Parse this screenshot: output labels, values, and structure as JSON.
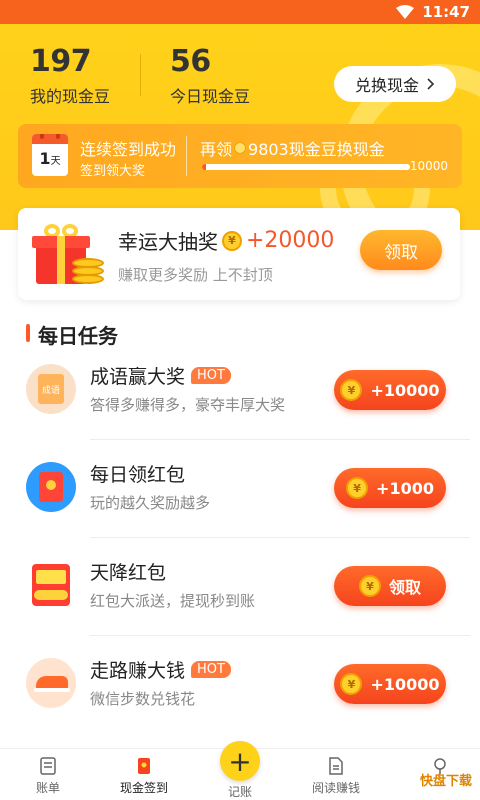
{
  "status_bar": {
    "time": "11:47"
  },
  "header": {
    "cash_balance": "197",
    "cash_balance_label": "我的现金豆",
    "today_balance": "56",
    "today_balance_label": "今日现金豆",
    "exchange_button": "兑换现金"
  },
  "signin": {
    "calendar_day": "1",
    "calendar_unit": "天",
    "title": "连续签到成功",
    "subtitle": "签到领大奖",
    "goal_prefix": "再领",
    "goal_suffix": "9803现金豆换现金",
    "progress_max": "10000",
    "progress_fraction": 0.0197
  },
  "lottery": {
    "title": "幸运大抽奖",
    "amount": "+20000",
    "subtitle": "赚取更多奖励 上不封顶",
    "button": "领取"
  },
  "daily_tasks": {
    "title": "每日任务",
    "items": [
      {
        "title": "成语赢大奖",
        "hot": "HOT",
        "subtitle": "答得多赚得多，豪夺丰厚大奖",
        "button": "+10000",
        "icon_text": "成语"
      },
      {
        "title": "每日领红包",
        "hot": "",
        "subtitle": "玩的越久奖励越多",
        "button": "+1000"
      },
      {
        "title": "天降红包",
        "hot": "",
        "subtitle": "红包大派送，提现秒到账",
        "button": "领取"
      },
      {
        "title": "走路赚大钱",
        "hot": "HOT",
        "subtitle": "微信步数兑钱花",
        "button": "+10000"
      }
    ]
  },
  "nav": {
    "items": [
      "账单",
      "现金签到",
      "记账",
      "阅读赚钱"
    ]
  },
  "watermark": "快盘下载",
  "colors": {
    "brand_yellow": "#ffd21a",
    "accent_red": "#f5441e",
    "status_bar": "#f7631c"
  }
}
